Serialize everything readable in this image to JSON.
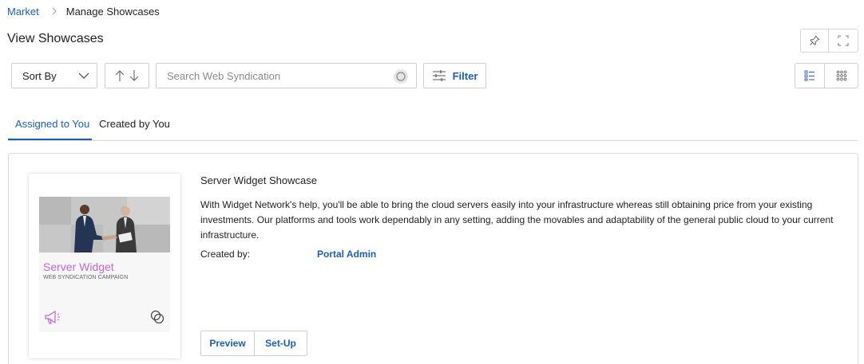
{
  "breadcrumb": {
    "parent": "Market",
    "current": "Manage Showcases"
  },
  "page": {
    "title": "View Showcases"
  },
  "toolbar": {
    "sort_label": "Sort By",
    "search_placeholder": "Search Web Syndication",
    "filter_label": "Filter"
  },
  "tabs": [
    {
      "label": "Assigned to You",
      "active": true
    },
    {
      "label": "Created by You",
      "active": false
    }
  ],
  "showcase": {
    "thumbnail": {
      "title": "Server Widget",
      "subtitle": "WEB SYNDICATION CAMPAIGN",
      "icons": [
        "megaphone-icon",
        "linked-circles-icon"
      ]
    },
    "title": "Server Widget Showcase",
    "description": "With Widget Network's help, you'll be able to bring the cloud servers easily into your infrastructure whereas still obtaining price from your existing investments. Our platforms and tools work dependably in any setting, adding the movables and adaptability of the general public cloud to your current infrastructure.",
    "created_by_label": "Created by:",
    "created_by_value": "Portal Admin",
    "actions": {
      "preview": "Preview",
      "setup": "Set-Up"
    }
  },
  "colors": {
    "accent": "#1a5fb4",
    "thumbnail_title": "#c266d9",
    "border": "#d0d0d0"
  }
}
